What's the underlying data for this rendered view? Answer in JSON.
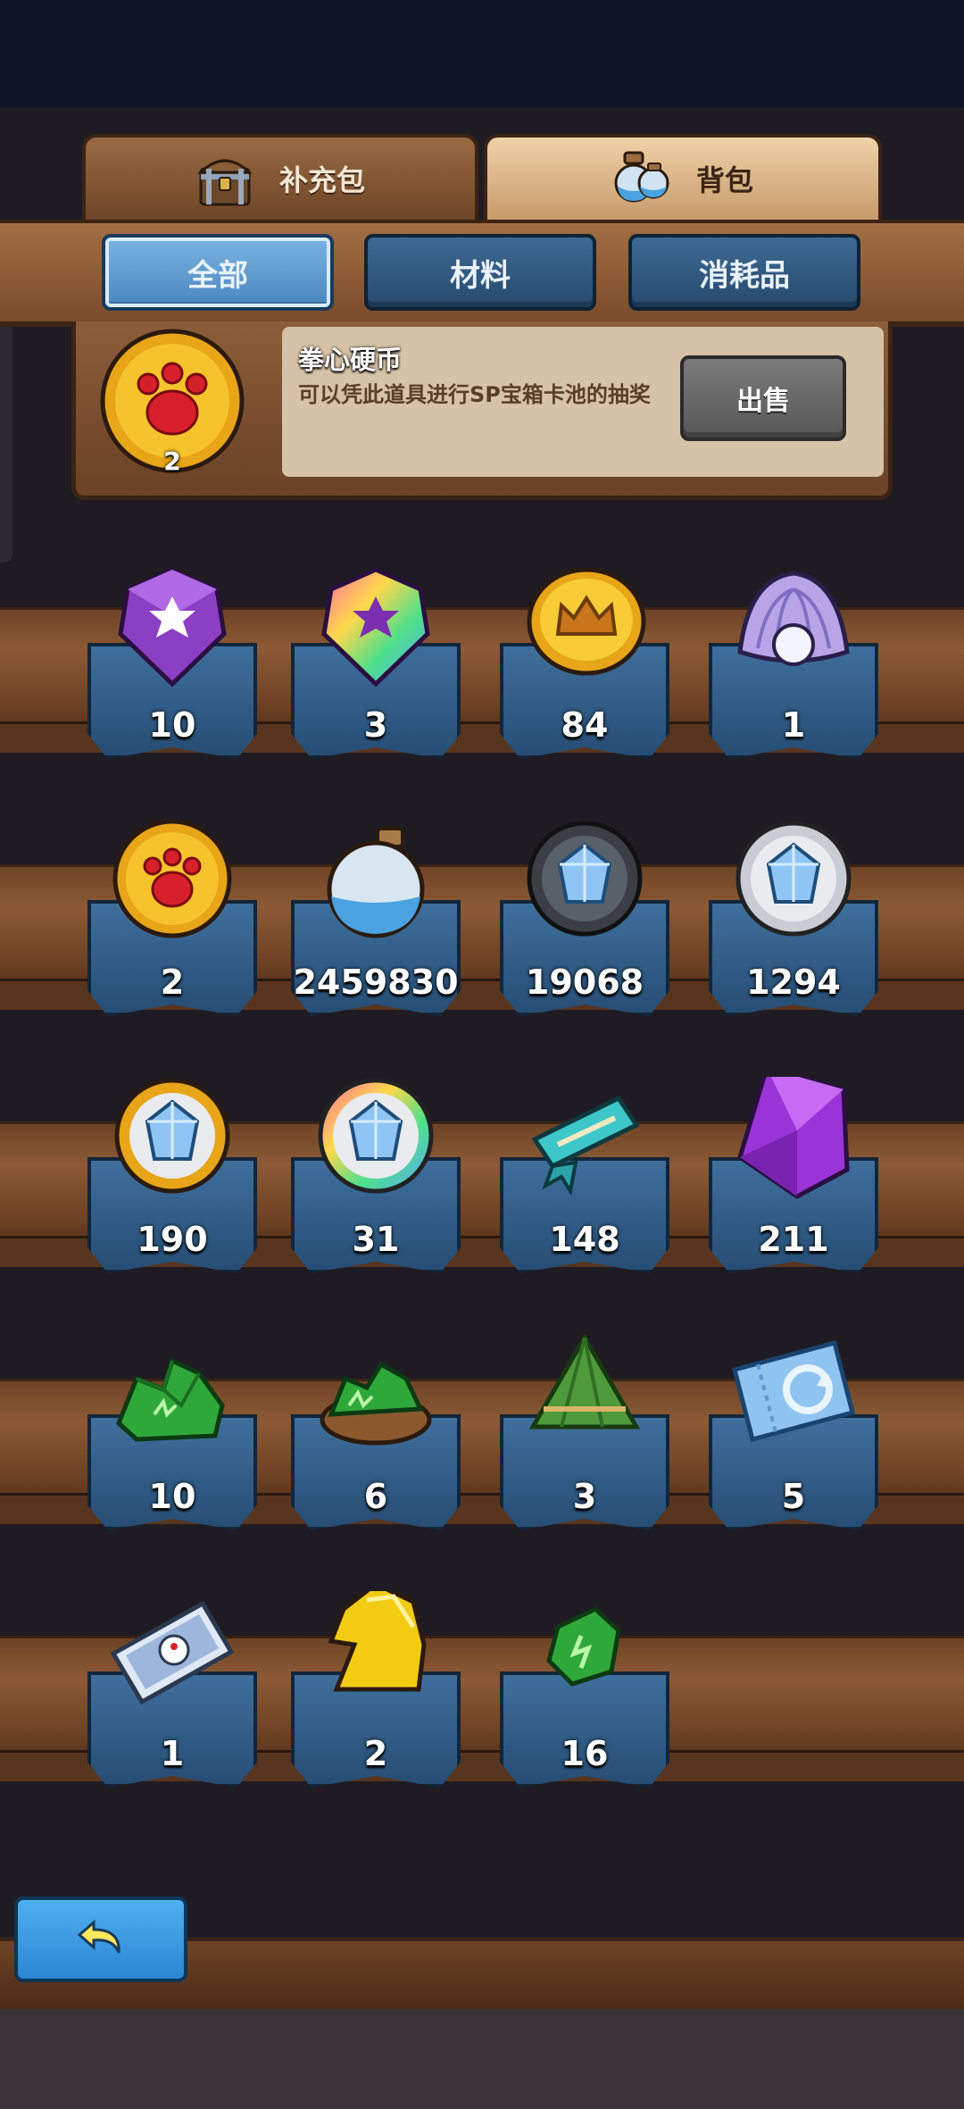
{
  "tabs": [
    {
      "label": "补充包",
      "icon": "treasure-chest-icon",
      "active": false
    },
    {
      "label": "背包",
      "icon": "potion-bottle-icon",
      "active": true
    }
  ],
  "filters": [
    {
      "label": "全部",
      "active": true
    },
    {
      "label": "材料",
      "active": false
    },
    {
      "label": "消耗品",
      "active": false
    }
  ],
  "detail": {
    "name": "拳心硬币",
    "description": "可以凭此道具进行SP宝箱卡池的抽奖",
    "count": "2",
    "icon": "paw-coin-icon",
    "sell_label": "出售"
  },
  "items": [
    {
      "count": "10",
      "icon": "purple-star-gem-icon"
    },
    {
      "count": "3",
      "icon": "rainbow-star-gem-icon"
    },
    {
      "count": "84",
      "icon": "gold-crown-coin-icon"
    },
    {
      "count": "1",
      "icon": "pearl-shell-icon"
    },
    {
      "count": "2",
      "icon": "paw-coin-icon"
    },
    {
      "count": "2459830",
      "icon": "blue-sand-bottle-icon"
    },
    {
      "count": "19068",
      "icon": "dark-crystal-orb-icon"
    },
    {
      "count": "1294",
      "icon": "silver-crystal-orb-icon"
    },
    {
      "count": "190",
      "icon": "gold-crystal-orb-icon"
    },
    {
      "count": "31",
      "icon": "rainbow-crystal-orb-icon"
    },
    {
      "count": "148",
      "icon": "scroll-ticket-icon"
    },
    {
      "count": "211",
      "icon": "purple-crystal-icon"
    },
    {
      "count": "10",
      "icon": "green-ore-pile-icon"
    },
    {
      "count": "6",
      "icon": "green-ore-sack-icon"
    },
    {
      "count": "3",
      "icon": "zongzi-icon"
    },
    {
      "count": "5",
      "icon": "refresh-ticket-icon"
    },
    {
      "count": "1",
      "icon": "character-ticket-icon"
    },
    {
      "count": "2",
      "icon": "golden-horse-icon"
    },
    {
      "count": "16",
      "icon": "green-ore-icon"
    }
  ],
  "colors": {
    "wood": "#8c5a34",
    "slot_blue": "#3f6f9d",
    "active_tab": "#4a86bf",
    "back_button": "#2a86d2"
  },
  "back_button": {
    "icon": "return-arrow-icon"
  }
}
